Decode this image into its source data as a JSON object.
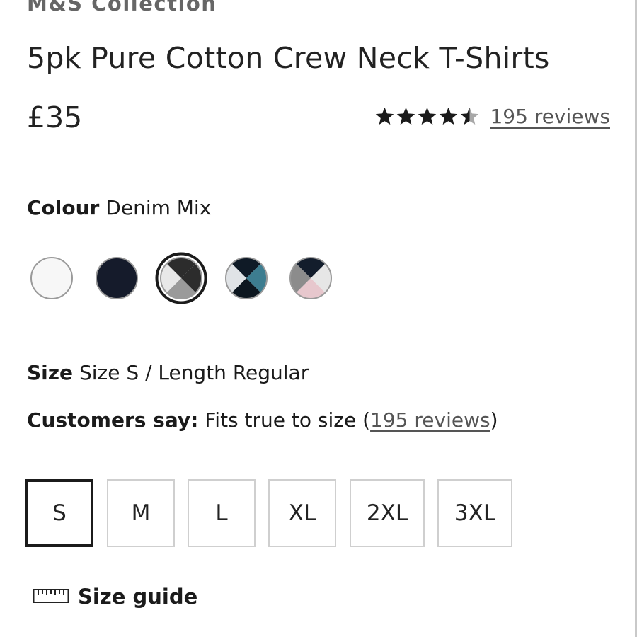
{
  "product": {
    "brand": "M&S Collection",
    "title": "5pk Pure Cotton Crew Neck T-Shirts",
    "price": "£35",
    "rating": 4.5,
    "reviews_link": "195 reviews"
  },
  "colour": {
    "label": "Colour",
    "selected_value": "Denim Mix",
    "swatches": [
      {
        "name": "White",
        "colors": [
          "#f7f7f7"
        ]
      },
      {
        "name": "Navy",
        "colors": [
          "#151b2b"
        ]
      },
      {
        "name": "Denim Mix",
        "colors": [
          "#2c2c2c",
          "#2c2c2c",
          "#9a9a9a",
          "#e8e8e8"
        ],
        "selected": true
      },
      {
        "name": "Blue Mix",
        "colors": [
          "#0f1a26",
          "#3d7d90",
          "#0d1720",
          "#e0e3e6"
        ]
      },
      {
        "name": "Grey Mix",
        "colors": [
          "#131d2c",
          "#e6e6e6",
          "#e7c7cd",
          "#8c8c8c"
        ]
      }
    ]
  },
  "size": {
    "label": "Size",
    "selected_value": "Size S / Length Regular",
    "customers_label": "Customers say:",
    "customers_value": "Fits true to size",
    "customers_paren_open": "(",
    "customers_link": "195 reviews",
    "customers_paren_close": ")",
    "options": [
      "S",
      "M",
      "L",
      "XL",
      "2XL",
      "3XL"
    ],
    "selected_index": 0,
    "guide_label": "Size guide"
  },
  "icons": {
    "star": "star-icon",
    "ruler": "ruler-icon"
  }
}
